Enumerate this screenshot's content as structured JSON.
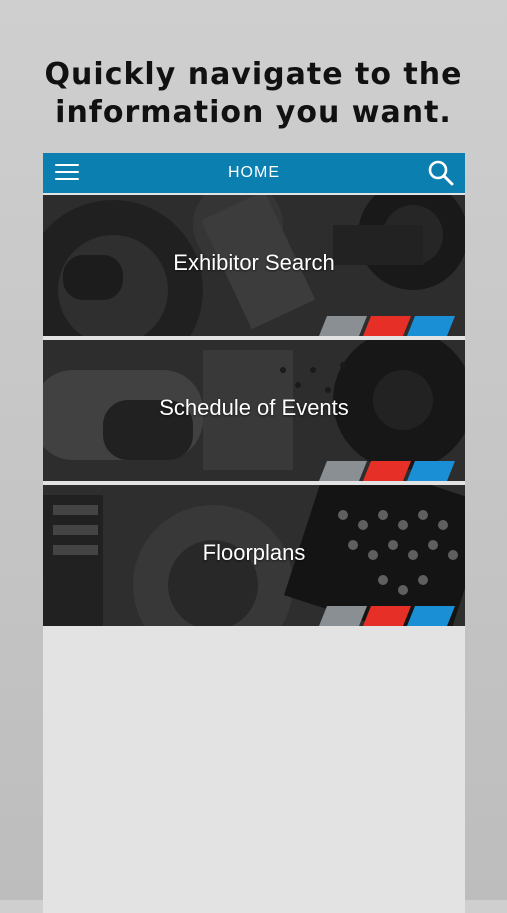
{
  "headline": {
    "line1": "Quickly navigate to the",
    "line2": "information you want."
  },
  "navbar": {
    "title": "HOME",
    "menu_icon": "hamburger-menu-icon",
    "search_icon": "search-icon",
    "color": "#0a7fb0"
  },
  "tiles": [
    {
      "label": "Exhibitor Search"
    },
    {
      "label": "Schedule of Events"
    },
    {
      "label": "Floorplans"
    }
  ],
  "accent_colors": {
    "gray": "#8a8f93",
    "red": "#e63027",
    "blue": "#1a8fd6"
  }
}
